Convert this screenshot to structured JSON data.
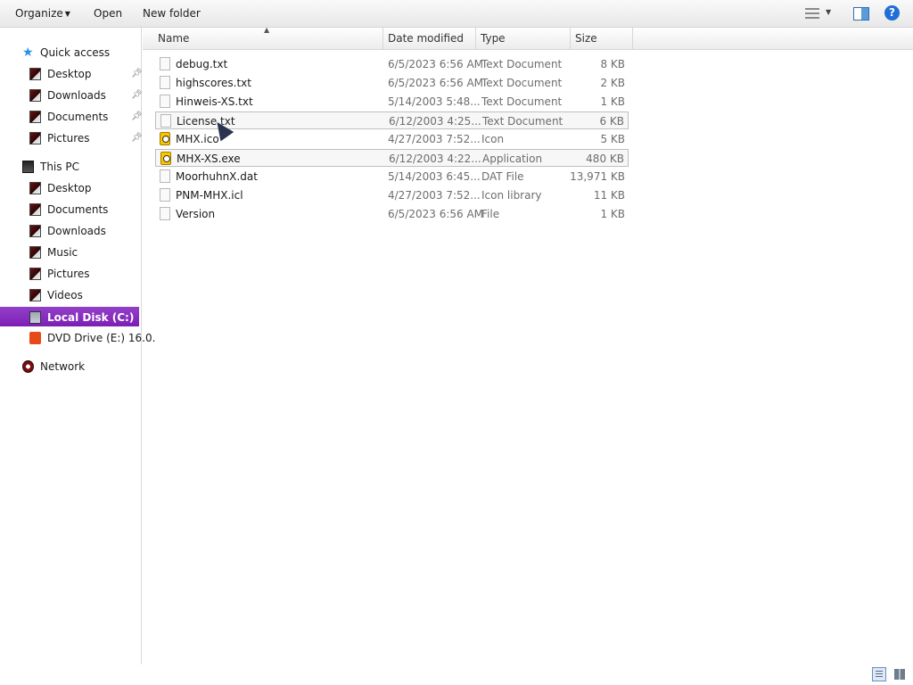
{
  "toolbar": {
    "organize_label": "Organize",
    "open_label": "Open",
    "new_folder_label": "New folder",
    "help_label": "?"
  },
  "nav": {
    "quick_access": {
      "label": "Quick access",
      "items": [
        {
          "label": "Desktop",
          "pinned": true
        },
        {
          "label": "Downloads",
          "pinned": true
        },
        {
          "label": "Documents",
          "pinned": true
        },
        {
          "label": "Pictures",
          "pinned": true
        }
      ]
    },
    "this_pc": {
      "label": "This PC",
      "items": [
        {
          "label": "Desktop"
        },
        {
          "label": "Documents"
        },
        {
          "label": "Downloads"
        },
        {
          "label": "Music"
        },
        {
          "label": "Pictures"
        },
        {
          "label": "Videos"
        },
        {
          "label": "Local Disk (C:)",
          "selected": true
        },
        {
          "label": "DVD Drive (E:) 16.0."
        }
      ]
    },
    "network": {
      "label": "Network"
    },
    "selection_color": "#8a2fc0"
  },
  "columns": {
    "name": "Name",
    "date_modified": "Date modified",
    "type": "Type",
    "size": "Size",
    "sort_column": "Name"
  },
  "files": [
    {
      "name": "debug.txt",
      "date": "6/5/2023 6:56 AM",
      "type": "Text Document",
      "size": "8 KB",
      "icon": "doc-icon"
    },
    {
      "name": "highscores.txt",
      "date": "6/5/2023 6:56 AM",
      "type": "Text Document",
      "size": "2 KB",
      "icon": "doc-icon"
    },
    {
      "name": "Hinweis-XS.txt",
      "date": "5/14/2003 5:48...",
      "type": "Text Document",
      "size": "1 KB",
      "icon": "doc-icon"
    },
    {
      "name": "License.txt",
      "date": "6/12/2003 4:25...",
      "type": "Text Document",
      "size": "6 KB",
      "icon": "doc-icon",
      "selected": true
    },
    {
      "name": "MHX.ico",
      "date": "4/27/2003 7:52...",
      "type": "Icon",
      "size": "5 KB",
      "icon": "app-icon"
    },
    {
      "name": "MHX-XS.exe",
      "date": "6/12/2003 4:22...",
      "type": "Application",
      "size": "480 KB",
      "icon": "app-icon",
      "selected": true
    },
    {
      "name": "MoorhuhnX.dat",
      "date": "5/14/2003 6:45...",
      "type": "DAT File",
      "size": "13,971 KB",
      "icon": "doc-icon"
    },
    {
      "name": "PNM-MHX.icl",
      "date": "4/27/2003 7:52...",
      "type": "Icon library",
      "size": "11 KB",
      "icon": "doc-icon"
    },
    {
      "name": "Version",
      "date": "6/5/2023 6:56 AM",
      "type": "File",
      "size": "1 KB",
      "icon": "doc-icon"
    }
  ]
}
